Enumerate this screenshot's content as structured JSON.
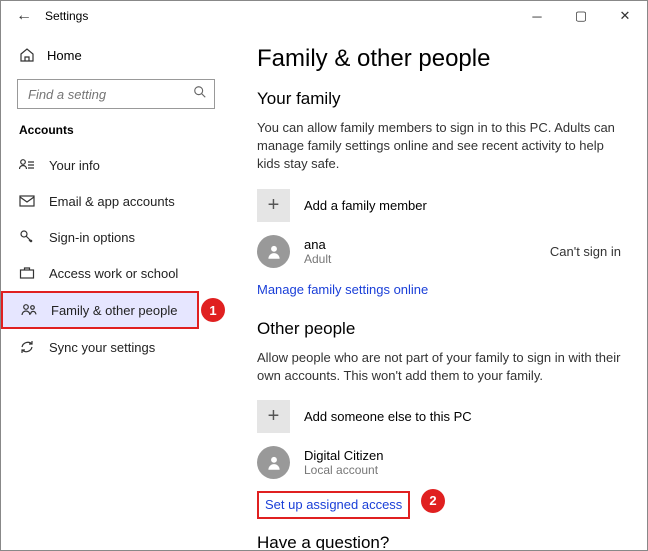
{
  "titlebar": {
    "title": "Settings"
  },
  "sidebar": {
    "home": "Home",
    "search_placeholder": "Find a setting",
    "group": "Accounts",
    "items": [
      {
        "label": "Your info"
      },
      {
        "label": "Email & app accounts"
      },
      {
        "label": "Sign-in options"
      },
      {
        "label": "Access work or school"
      },
      {
        "label": "Family & other people"
      },
      {
        "label": "Sync your settings"
      }
    ]
  },
  "main": {
    "heading": "Family & other people",
    "family": {
      "title": "Your family",
      "desc": "You can allow family members to sign in to this PC. Adults can manage family settings online and see recent activity to help kids stay safe.",
      "add_label": "Add a family member",
      "member": {
        "name": "ana",
        "role": "Adult",
        "status": "Can't sign in"
      },
      "manage_link": "Manage family settings online"
    },
    "other": {
      "title": "Other people",
      "desc": "Allow people who are not part of your family to sign in with their own accounts. This won't add them to your family.",
      "add_label": "Add someone else to this PC",
      "member": {
        "name": "Digital Citizen",
        "role": "Local account"
      },
      "assigned_link": "Set up assigned access"
    },
    "question": "Have a question?"
  },
  "annotations": {
    "badge1": "1",
    "badge2": "2"
  }
}
